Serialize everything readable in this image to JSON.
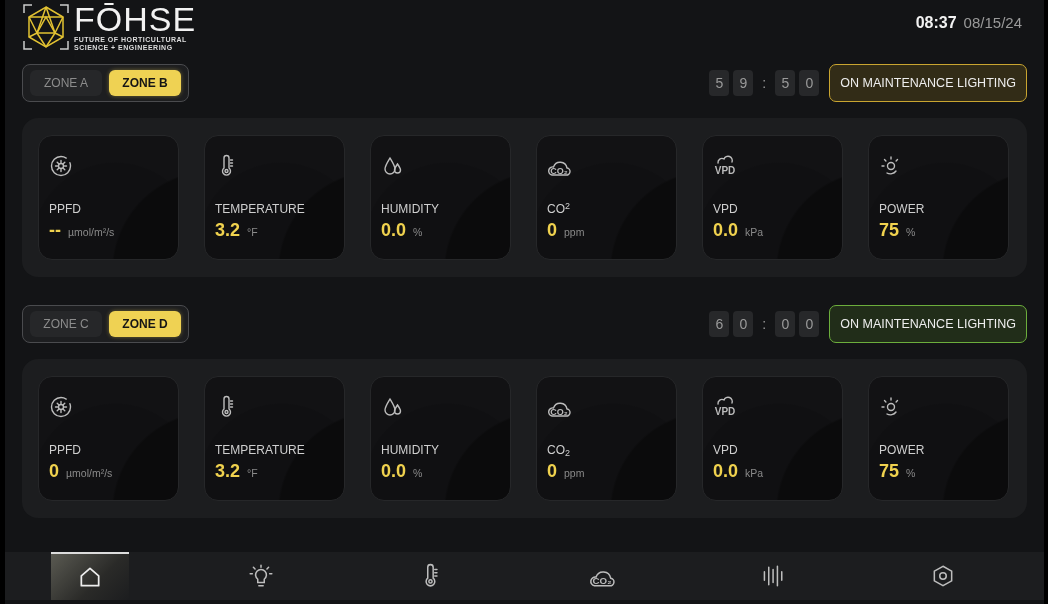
{
  "header": {
    "logo": {
      "name": "FŌHSE",
      "tagline_lines": [
        "FUTURE OF HORTICULTURAL",
        "SCIENCE + ENGINEERING"
      ]
    },
    "time": "08:37",
    "date": "08/15/24"
  },
  "sections": [
    {
      "zones": [
        {
          "label": "ZONE A",
          "selected": false
        },
        {
          "label": "ZONE B",
          "selected": true
        }
      ],
      "timer": [
        {
          "kind": "digit",
          "text": "5"
        },
        {
          "kind": "digit",
          "text": "9"
        },
        {
          "kind": "separator",
          "text": ":"
        },
        {
          "kind": "digit",
          "text": "5"
        },
        {
          "kind": "digit",
          "text": "0"
        }
      ],
      "action": {
        "label": "ON MAINTENANCE LIGHTING",
        "color": "#c9a530"
      },
      "metrics": [
        {
          "kind": "ppfd",
          "label": "PPFD",
          "value": "--",
          "unit": "µmol/m²/s"
        },
        {
          "kind": "temperature",
          "label": "TEMPERATURE",
          "value": "3.2",
          "unit": "°F"
        },
        {
          "kind": "humidity",
          "label": "HUMIDITY",
          "value": "0.0",
          "unit": "%"
        },
        {
          "kind": "co2",
          "icon_text": "CO₂",
          "label": "CO$^{2}$",
          "value": "0",
          "unit": "ppm"
        },
        {
          "kind": "vpd",
          "icon_text": "VPD",
          "label": "VPD",
          "value": "0.0",
          "unit": "kPa"
        },
        {
          "kind": "power",
          "label": "POWER",
          "value": "75",
          "unit": "%"
        }
      ]
    },
    {
      "zones": [
        {
          "label": "ZONE C",
          "selected": false
        },
        {
          "label": "ZONE D",
          "selected": true
        }
      ],
      "timer": [
        {
          "kind": "digit",
          "text": "6"
        },
        {
          "kind": "digit",
          "text": "0"
        },
        {
          "kind": "separator",
          "text": ":"
        },
        {
          "kind": "digit",
          "text": "0"
        },
        {
          "kind": "digit",
          "text": "0"
        }
      ],
      "action": {
        "label": "ON MAINTENANCE LIGHTING",
        "color": "#6cae3c"
      },
      "metrics": [
        {
          "kind": "ppfd",
          "label": "PPFD",
          "value": "0",
          "unit": "µmol/m²/s"
        },
        {
          "kind": "temperature",
          "label": "TEMPERATURE",
          "value": "3.2",
          "unit": "°F"
        },
        {
          "kind": "humidity",
          "label": "HUMIDITY",
          "value": "0.0",
          "unit": "%"
        },
        {
          "kind": "co2",
          "icon_text": "CO₂",
          "label": "CO$_{2}$",
          "value": "0",
          "unit": "ppm"
        },
        {
          "kind": "vpd",
          "icon_text": "VPD",
          "label": "VPD",
          "value": "0.0",
          "unit": "kPa"
        },
        {
          "kind": "power",
          "label": "POWER",
          "value": "75",
          "unit": "%"
        }
      ]
    }
  ],
  "nav": [
    {
      "kind": "home",
      "selected": true
    },
    {
      "kind": "light",
      "selected": false
    },
    {
      "kind": "temperature",
      "selected": false
    },
    {
      "kind": "co2",
      "icon_text": "CO₂",
      "selected": false
    },
    {
      "kind": "waves",
      "selected": false
    },
    {
      "kind": "settings",
      "selected": false
    }
  ]
}
